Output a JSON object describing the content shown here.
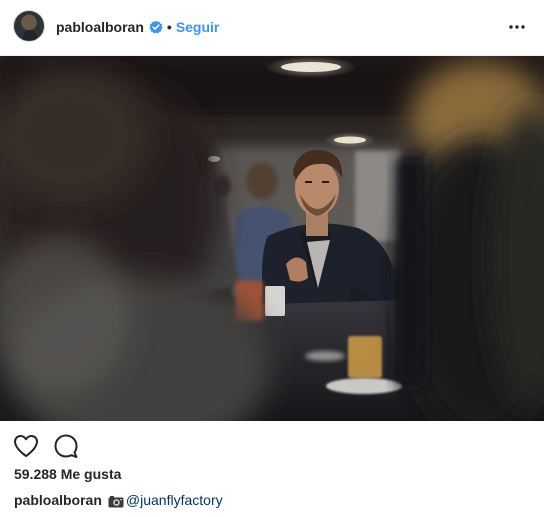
{
  "header": {
    "username": "pabloalboran",
    "separator": "•",
    "follow_label": "Seguir",
    "verified_icon": "verified-badge-icon",
    "more_icon": "more-options-icon"
  },
  "photo": {
    "description_icon": "post-photo"
  },
  "actions": {
    "like_icon": "heart-icon",
    "comment_icon": "comment-icon"
  },
  "likes": {
    "text": "59.288 Me gusta"
  },
  "caption": {
    "username": "pabloalboran",
    "emoji_icon": "camera-icon",
    "mention": "@juanflyfactory"
  },
  "colors": {
    "link_blue": "#3897f0",
    "mention_blue": "#003569",
    "text": "#262626",
    "border": "#efefef"
  }
}
